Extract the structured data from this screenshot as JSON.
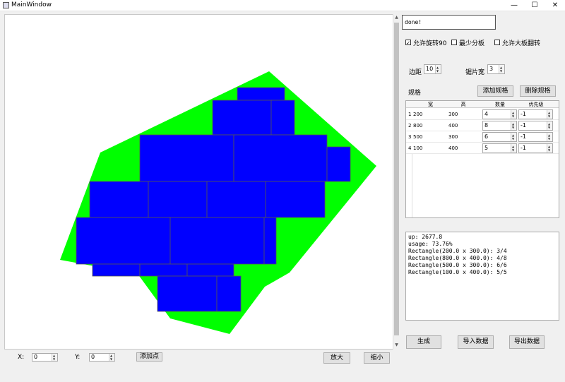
{
  "window": {
    "title": "MainWindow",
    "minimize": "—",
    "maximize": "☐",
    "close": "✕"
  },
  "status_text": "done!",
  "options": {
    "allow_rotate": {
      "label": "允许旋转90",
      "checked": true
    },
    "min_boards": {
      "label": "最少分板",
      "checked": false
    },
    "allow_flip": {
      "label": "允许大板翻转",
      "checked": false
    }
  },
  "margin": {
    "label": "边距",
    "value": "10"
  },
  "blade": {
    "label": "锯片宽",
    "value": "3"
  },
  "spec": {
    "label": "规格",
    "add_label": "添加规格",
    "delete_label": "删除规格",
    "headers": [
      "宽",
      "高",
      "数量",
      "优先级"
    ],
    "rows": [
      {
        "idx": "1",
        "w": "200",
        "h": "300",
        "qty": "4",
        "pri": "-1"
      },
      {
        "idx": "2",
        "w": "800",
        "h": "400",
        "qty": "8",
        "pri": "-1"
      },
      {
        "idx": "3",
        "w": "500",
        "h": "300",
        "qty": "6",
        "pri": "-1"
      },
      {
        "idx": "4",
        "w": "100",
        "h": "400",
        "qty": "5",
        "pri": "-1"
      }
    ]
  },
  "log_lines": [
    "up: 2677.8",
    "usage: 73.76%",
    "Rectangle(200.0 x 300.0): 3/4",
    "Rectangle(800.0 x 400.0): 4/8",
    "Rectangle(500.0 x 300.0): 6/6",
    "Rectangle(100.0 x 400.0): 5/5"
  ],
  "actions": {
    "generate": "生成",
    "import": "导入数据",
    "export": "导出数据"
  },
  "bottom": {
    "x_label": "X:",
    "x_value": "0",
    "y_label": "Y:",
    "y_value": "0",
    "add_point": "添加点",
    "zoom_in": "放大",
    "zoom_out": "缩小"
  },
  "colors": {
    "board": "#00ff00",
    "piece": "#0000ff",
    "piece_border": "#555555"
  }
}
